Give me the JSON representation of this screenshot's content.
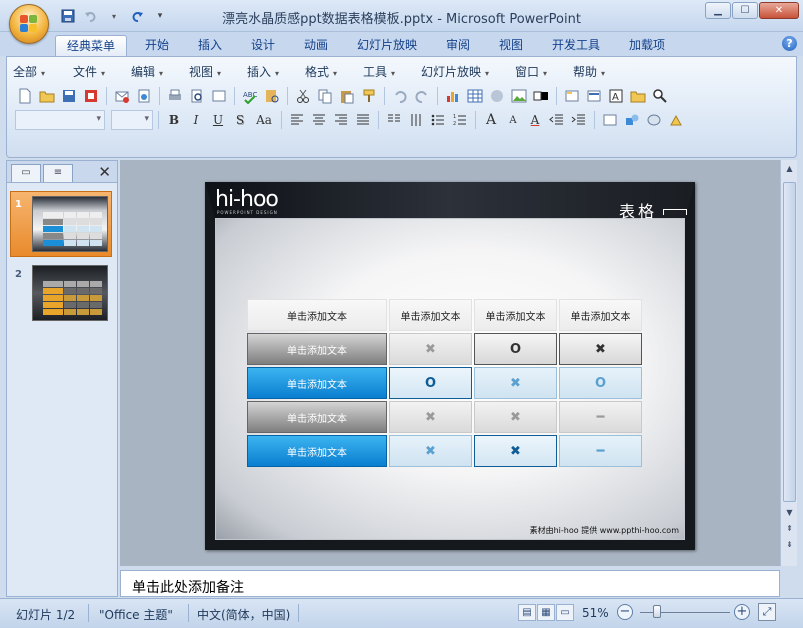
{
  "window": {
    "title": "漂亮水晶质感ppt数据表格模板.pptx - Microsoft PowerPoint",
    "minimize": "▁",
    "maximize": "☐",
    "close": "✕"
  },
  "quick_access": {
    "save_icon": "save-icon",
    "undo_icon": "undo-icon",
    "redo_icon": "redo-icon",
    "customize": "▾"
  },
  "ribbon_tabs": [
    "经典菜单",
    "开始",
    "插入",
    "设计",
    "动画",
    "幻灯片放映",
    "审阅",
    "视图",
    "开发工具",
    "加载项"
  ],
  "active_tab": "经典菜单",
  "help": "?",
  "classic_menu": [
    "全部",
    "文件",
    "编辑",
    "视图",
    "插入",
    "格式",
    "工具",
    "幻灯片放映",
    "窗口",
    "帮助"
  ],
  "format_buttons": {
    "bold": "B",
    "italic": "I",
    "underline": "U",
    "shadow": "S",
    "change_case": "Aa",
    "font_grow": "A",
    "font_shrink": "A",
    "font_color": "A"
  },
  "left_pane": {
    "tab_slides_icon": "slides-tab-icon",
    "tab_outline_icon": "outline-tab-icon",
    "close": "✕",
    "slide_numbers": [
      "1",
      "2"
    ]
  },
  "slide": {
    "logo": "hi-hoo",
    "logo_sub": "POWERPOINT DESIGN",
    "title": "表格",
    "credit": "素材由hi-hoo 提供  www.ppthi-hoo.com",
    "table": {
      "header": [
        "单击添加文本",
        "单击添加文本",
        "单击添加文本",
        "单击添加文本"
      ],
      "rows": [
        {
          "label": "单击添加文本",
          "style": "gray",
          "cells": [
            {
              "sym": "✖",
              "style": "gray",
              "color": "#9a9a9a"
            },
            {
              "sym": "O",
              "style": "gray-dark",
              "color": "#333333"
            },
            {
              "sym": "✖",
              "style": "gray-dark",
              "color": "#333333"
            }
          ]
        },
        {
          "label": "单击添加文本",
          "style": "blue",
          "cells": [
            {
              "sym": "O",
              "style": "blue-dark",
              "color": "#0f5c97"
            },
            {
              "sym": "✖",
              "style": "blue",
              "color": "#5aa0d0"
            },
            {
              "sym": "O",
              "style": "blue",
              "color": "#5aa0d0"
            }
          ]
        },
        {
          "label": "单击添加文本",
          "style": "gray",
          "cells": [
            {
              "sym": "✖",
              "style": "gray",
              "color": "#9a9a9a"
            },
            {
              "sym": "✖",
              "style": "gray",
              "color": "#9a9a9a"
            },
            {
              "sym": "━",
              "style": "gray",
              "color": "#9a9a9a"
            }
          ]
        },
        {
          "label": "单击添加文本",
          "style": "blue",
          "cells": [
            {
              "sym": "✖",
              "style": "blue",
              "color": "#5aa0d0"
            },
            {
              "sym": "✖",
              "style": "blue-dark",
              "color": "#0f5c97"
            },
            {
              "sym": "━",
              "style": "blue",
              "color": "#5aa0d0"
            }
          ]
        }
      ]
    }
  },
  "notes_placeholder": "单击此处添加备注",
  "status": {
    "slide_count": "幻灯片 1/2",
    "theme": "\"Office 主题\"",
    "language": "中文(简体，中国)",
    "zoom": "51%",
    "zoom_minus": "−",
    "zoom_plus": "+",
    "zoom_level": 0.51
  }
}
